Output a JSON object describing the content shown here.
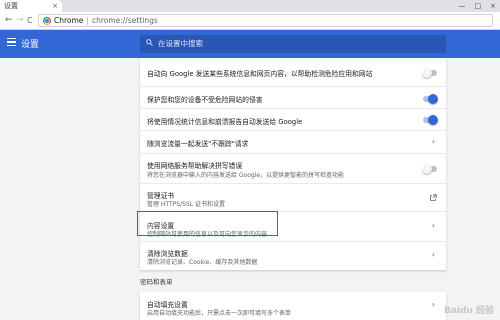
{
  "tab": {
    "title": "设置",
    "close": "×"
  },
  "window_controls": {
    "minimize": "—",
    "maximize": "□",
    "close": "×"
  },
  "toolbar": {
    "back": "←",
    "forward": "→",
    "reload": "C"
  },
  "omnibox": {
    "site": "Chrome",
    "separator": "|",
    "url": "chrome://settings"
  },
  "header": {
    "title": "设置",
    "search_placeholder": "在设置中搜索"
  },
  "settings": {
    "rows": [
      {
        "title": "自动向 Google 发送某些系统信息和网页内容，以帮助检测危险应用和网站",
        "control": "off"
      },
      {
        "title": "保护您和您的设备不受危险网站的侵害",
        "control": "on"
      },
      {
        "title": "将使用情况统计信息和崩溃报告自动发送给 Google",
        "control": "on"
      },
      {
        "title": "随浏览流量一起发送\"不跟踪\"请求",
        "control": "chevron"
      },
      {
        "title": "使用网络服务帮助解决拼写错误",
        "subtitle": "将您在浏览器中输入的内容发送给 Google，以提供更智能的拼写检查功能",
        "control": "off"
      },
      {
        "title": "管理证书",
        "subtitle": "管理 HTTPS/SSL 证书和设置",
        "control": "external"
      },
      {
        "title": "内容设置",
        "subtitle": "控制网站可使用的信息以及可向您显示的内容",
        "control": "chevron"
      },
      {
        "title": "清除浏览数据",
        "subtitle": "清除浏览记录、Cookie、缓存及其他数据",
        "control": "chevron"
      }
    ]
  },
  "passwords_section": {
    "title": "密码和表单",
    "autofill_title": "自动填充设置",
    "autofill_subtitle": "启用自动填充功能后，只需点击一次即可填写多个表单"
  },
  "watermark": "Baidu 经验",
  "colors": {
    "accent": "#3367d6",
    "highlight": "#d93025"
  }
}
